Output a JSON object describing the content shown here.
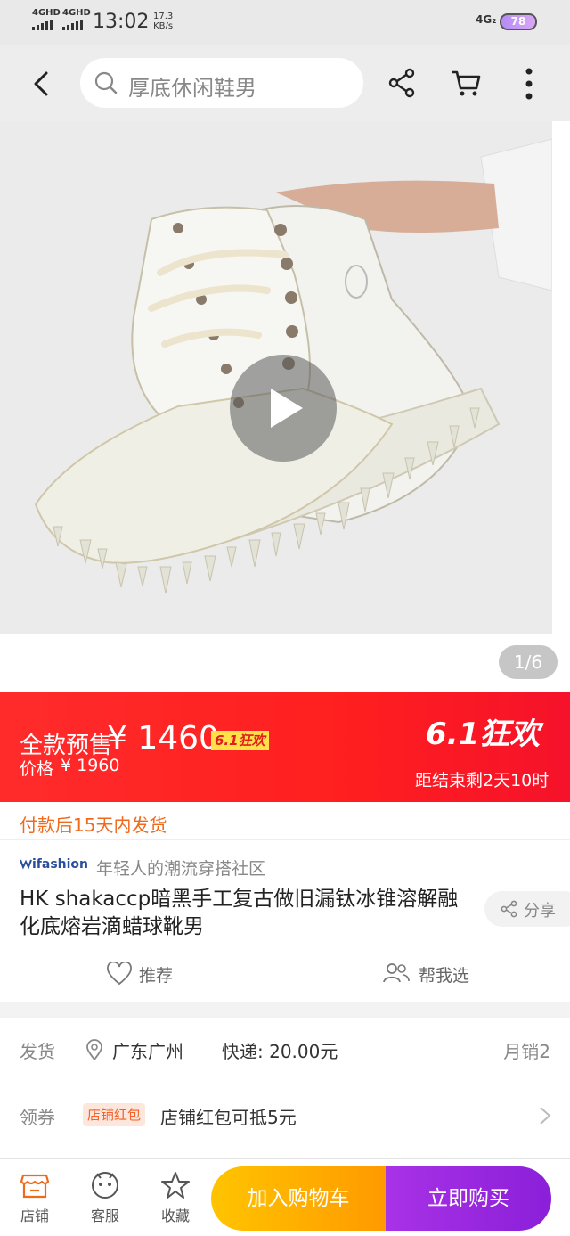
{
  "status_bar": {
    "net1": "4GHD",
    "net2": "4GHD",
    "time": "13:02",
    "speed_value": "17.3",
    "speed_unit": "KB/s",
    "net3": "4G₂",
    "battery": "78"
  },
  "nav": {
    "search_placeholder": "厚底休闲鞋男"
  },
  "media": {
    "counter": "1/6"
  },
  "price": {
    "presale_label": "全款预售",
    "presale_price": "¥ 1460",
    "badge": "6.1狂欢",
    "orig_label": "价格",
    "orig_price": "¥ 1960",
    "promo_title": "6.1狂欢",
    "countdown": "距结束剩2天10时"
  },
  "ship_note": "付款后15天内发货",
  "brand": {
    "logo": "ifashion",
    "tagline": "年轻人的潮流穿搭社区"
  },
  "product": {
    "title": "HK shakaccp暗黑手工复古做旧漏钛冰锥溶解融化底熔岩滴蜡球靴男",
    "share_label": "分享",
    "recommend_label": "推荐",
    "help_label": "帮我选"
  },
  "delivery": {
    "label": "发货",
    "location": "广东广州",
    "express": "快递: 20.00元",
    "monthly_sales": "月销2"
  },
  "coupon": {
    "label": "领券",
    "tag": "店铺红包",
    "text": "店铺红包可抵5元"
  },
  "bottom": {
    "store": "店铺",
    "service": "客服",
    "favorite": "收藏",
    "add_cart": "加入购物车",
    "buy_now": "立即购买"
  },
  "colors": {
    "banner_red": "#ff2b2b",
    "orange": "#f06a1c",
    "cart_yellow": "#ffc400",
    "buy_purple": "#8b1fd9"
  }
}
